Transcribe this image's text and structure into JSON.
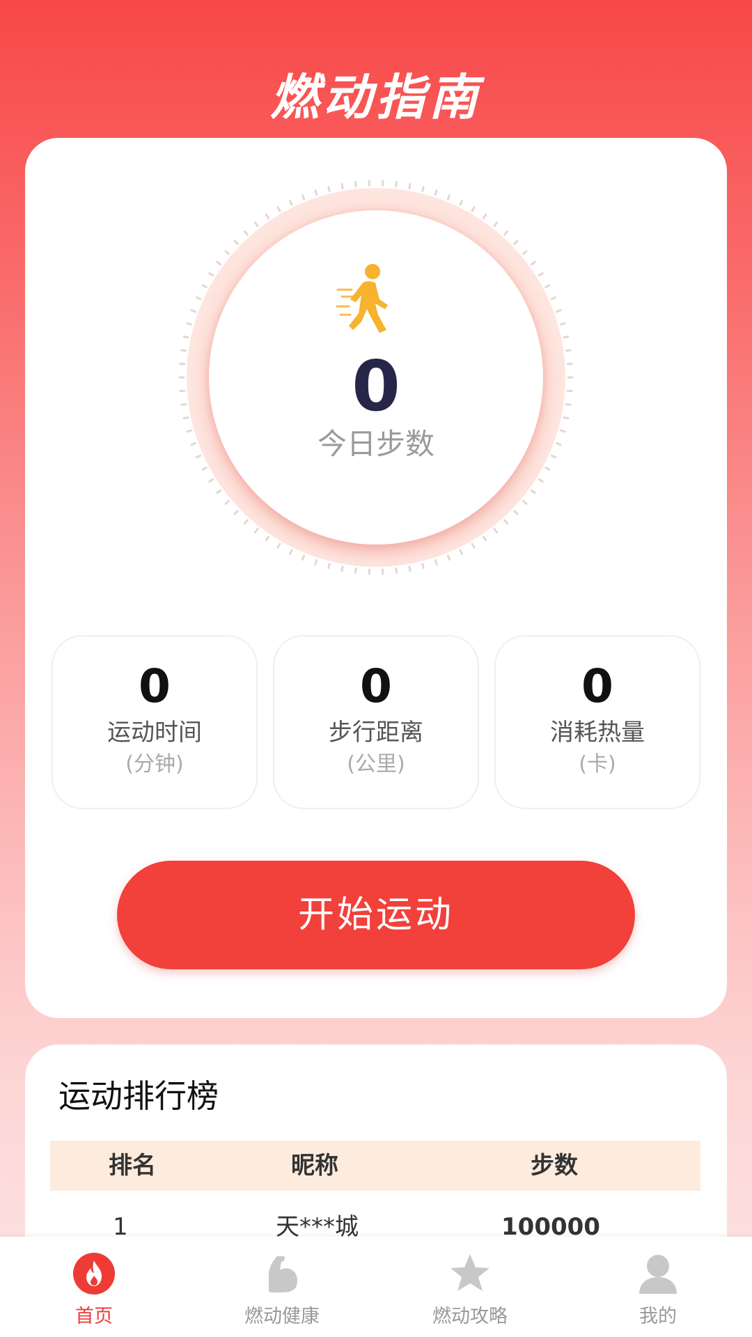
{
  "header": {
    "title": "燃动指南"
  },
  "steps": {
    "value": "0",
    "label": "今日步数"
  },
  "stats": [
    {
      "value": "0",
      "label": "运动时间",
      "unit": "(分钟)"
    },
    {
      "value": "0",
      "label": "步行距离",
      "unit": "(公里)"
    },
    {
      "value": "0",
      "label": "消耗热量",
      "unit": "(卡)"
    }
  ],
  "start_button": {
    "label": "开始运动"
  },
  "leaderboard": {
    "title": "运动排行榜",
    "columns": [
      "排名",
      "昵称",
      "步数"
    ],
    "rows": [
      {
        "rank": "1",
        "nickname": "天***城",
        "steps": "100000"
      }
    ]
  },
  "tabs": [
    {
      "label": "首页",
      "icon": "fire-icon",
      "active": true
    },
    {
      "label": "燃动健康",
      "icon": "flexed-arm-icon",
      "active": false
    },
    {
      "label": "燃动攻略",
      "icon": "star-icon",
      "active": false
    },
    {
      "label": "我的",
      "icon": "user-icon",
      "active": false
    }
  ],
  "colors": {
    "accent": "#f2403b",
    "header_gradient_top": "#f84848",
    "runner": "#f7b22e",
    "tab_inactive": "#c8c8c8",
    "table_header_bg": "#fdebde"
  }
}
